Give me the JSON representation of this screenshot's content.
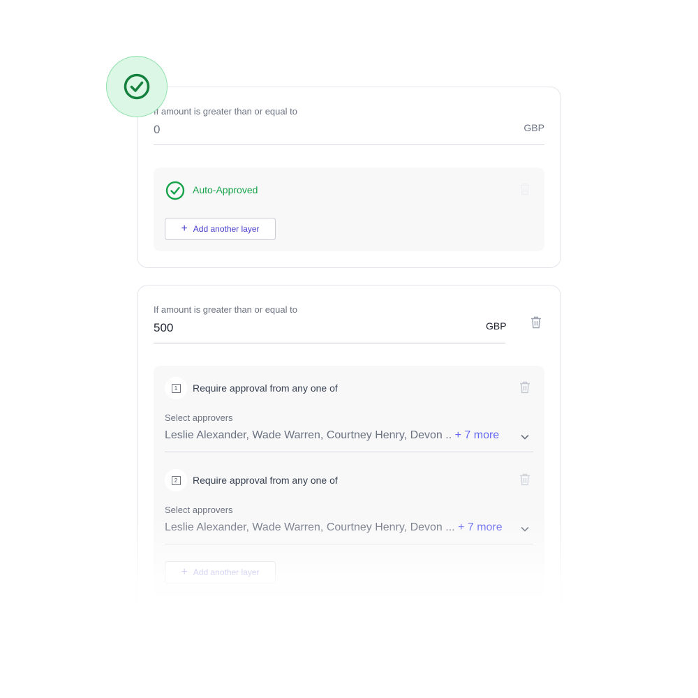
{
  "tier1": {
    "label": "If amount is greater than or equal to",
    "amount": "0",
    "currency": "GBP",
    "status": "Auto-Approved",
    "add_layer": "Add another layer"
  },
  "tier2": {
    "label": "If amount is greater than or equal to",
    "amount": "500",
    "currency": "GBP",
    "layers": [
      {
        "number": "1",
        "title": "Require approval from any one of",
        "select_label": "Select approvers",
        "approvers": "Leslie Alexander, Wade Warren, Courtney Henry, Devon ..",
        "more": "+ 7 more"
      },
      {
        "number": "2",
        "title": "Require approval from any one of",
        "select_label": "Select approvers",
        "approvers": "Leslie Alexander, Wade Warren, Courtney Henry, Devon ...",
        "more": "+ 7 more"
      }
    ],
    "add_layer": "Add another layer"
  },
  "colors": {
    "success": "#16a34a",
    "badge_bg": "#dcf7e6",
    "accent": "#4338ca",
    "more_link": "#6366f1"
  },
  "icons": {
    "badge": "check-circle-icon",
    "status": "check-circle-icon",
    "delete": "trash-icon",
    "dropdown": "chevron-down-icon"
  }
}
